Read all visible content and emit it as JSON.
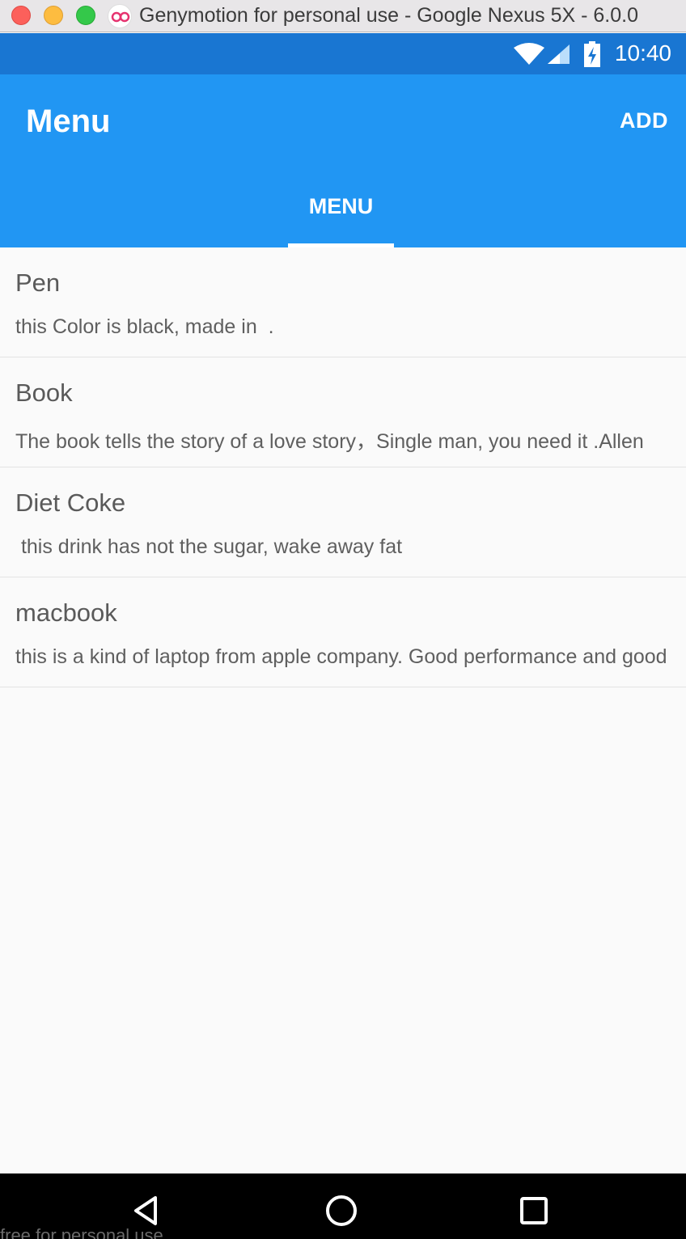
{
  "window": {
    "title": "Genymotion for personal use - Google Nexus 5X - 6.0.0"
  },
  "status_bar": {
    "time": "10:40",
    "icons": [
      "wifi-icon",
      "signal-icon",
      "battery-charging-icon"
    ]
  },
  "app_bar": {
    "title": "Menu",
    "add_label": "ADD"
  },
  "tabs": [
    {
      "label": "MENU",
      "selected": true
    }
  ],
  "items": [
    {
      "title": "Pen",
      "description": "this Color is black, made in  ."
    },
    {
      "title": "Book",
      "description": "The book tells the story of a love story，Single man, you need it .Allen"
    },
    {
      "title": "Diet Coke",
      "description": " this drink has not the sugar, wake away fat"
    },
    {
      "title": "macbook",
      "description": "this is a kind of laptop from apple company. Good performance and good"
    }
  ],
  "nav_bar": {
    "buttons": [
      "back-icon",
      "home-icon",
      "recent-apps-icon"
    ]
  },
  "watermark": "free for personal use",
  "colors": {
    "app_bar": "#2196f3",
    "status_bar": "#1976d2",
    "background": "#fafafa"
  }
}
